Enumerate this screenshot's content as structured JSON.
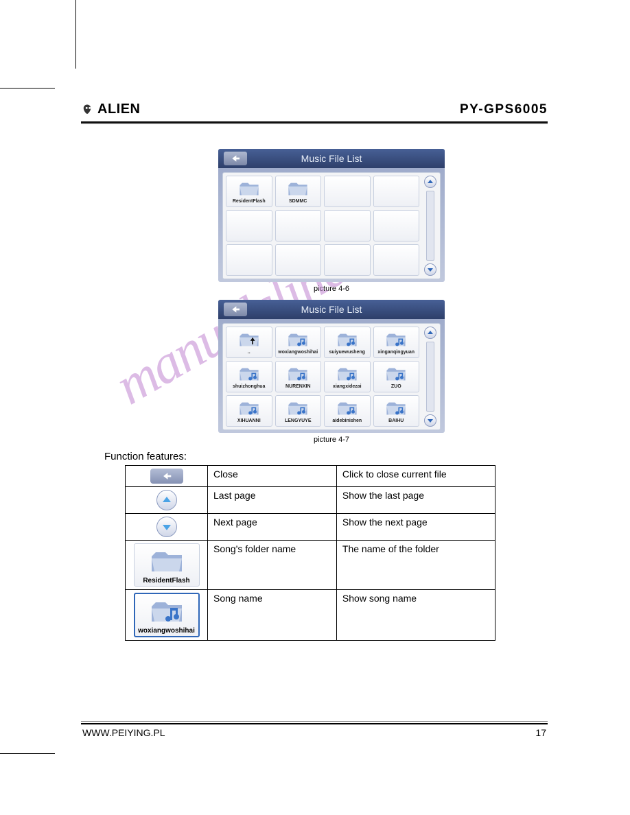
{
  "header": {
    "brand": "ALIEN",
    "model": "PY-GPS6005"
  },
  "footer": {
    "url": "WWW.PEIYING.PL",
    "page_number": "17"
  },
  "watermark": "manualsline.com",
  "shot1": {
    "title": "Music File List",
    "items": [
      "ResidentFlash",
      "SDMMC",
      "",
      "",
      "",
      "",
      "",
      "",
      "",
      "",
      "",
      ""
    ],
    "caption": "picture 4-6"
  },
  "shot2": {
    "title": "Music File List",
    "items": [
      "..",
      "woxiangwoshihai",
      "suiyuewusheng",
      "xinganqingyuan",
      "shuizhonghua",
      "NURENXIN",
      "xiangxidezai",
      "ZUO",
      "XIHUANNI",
      "LENGYUYE",
      "aidebinishen",
      "BAIHU"
    ],
    "caption": "picture 4-7"
  },
  "section_title": "Function features:",
  "features": [
    {
      "name": "Close",
      "desc": "Click to close current file",
      "icon": "close"
    },
    {
      "name": "Last page",
      "desc": "Show the last page",
      "icon": "up"
    },
    {
      "name": "Next page",
      "desc": "Show the next page",
      "icon": "down"
    },
    {
      "name": "Song's folder name",
      "desc": "The name of the folder",
      "icon": "folder",
      "sample_label": "ResidentFlash"
    },
    {
      "name": "Song name",
      "desc": "Show song name",
      "icon": "music",
      "sample_label": "woxiangwoshihai"
    }
  ]
}
